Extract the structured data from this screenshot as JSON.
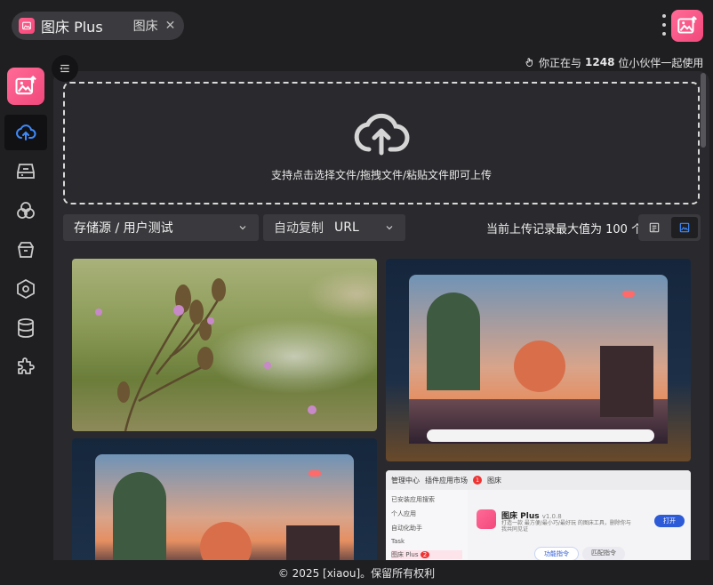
{
  "header": {
    "app_title": "图床 Plus",
    "tab_label": "图床",
    "close_glyph": "✕"
  },
  "status": {
    "prefix": "你正在与",
    "count": "1248",
    "suffix": "位小伙伴一起使用"
  },
  "upload": {
    "hint": "支持点击选择文件/拖拽文件/粘贴文件即可上传"
  },
  "toolbar": {
    "storage_value": "存储源 / 用户测试",
    "auto_copy_label": "自动复制",
    "auto_copy_value": "URL",
    "max_records_text": "当前上传记录最大值为 100 个"
  },
  "sidebar": {
    "items": [
      {
        "name": "upload",
        "icon": "cloud-upload-icon",
        "active": true
      },
      {
        "name": "storage",
        "icon": "drive-icon"
      },
      {
        "name": "circles",
        "icon": "circles-icon"
      },
      {
        "name": "box",
        "icon": "box-icon"
      },
      {
        "name": "hexagon",
        "icon": "hexagon-icon"
      },
      {
        "name": "database",
        "icon": "database-icon"
      },
      {
        "name": "plugin",
        "icon": "puzzle-icon"
      }
    ]
  },
  "gallery": {
    "app_shot": {
      "tab1": "管理中心",
      "tab2": "插件应用市场",
      "tab3": "图床",
      "badge": "1",
      "side_search": "已安装应用搜索",
      "side_group": "个人应用",
      "side_item1": "自动化助手",
      "side_item2": "Task",
      "side_item3": "图床 Plus",
      "side_badge": "2",
      "title": "图床 Plus",
      "version": "v1.0.8",
      "desc": "打造一款 最方便/最小巧/最好玩 的图床工具，删除你与我共同见证",
      "open": "打开",
      "tab_a": "功能指令",
      "tab_b": "匹配指令"
    }
  },
  "footer": {
    "text": "© 2025 [xiaou]。保留所有权利"
  },
  "colors": {
    "accent_pink": "#f2487c",
    "active_blue": "#3d8bff",
    "background": "#1f1f22",
    "panel": "#2a2a2e"
  }
}
